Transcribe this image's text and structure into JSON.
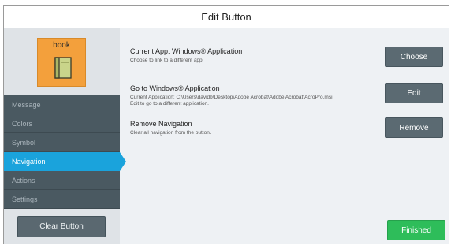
{
  "dialog": {
    "title": "Edit Button"
  },
  "preview": {
    "label": "book",
    "icon": "book-icon"
  },
  "sidebar": {
    "items": [
      {
        "label": "Message",
        "active": false
      },
      {
        "label": "Colors",
        "active": false
      },
      {
        "label": "Symbol",
        "active": false
      },
      {
        "label": "Navigation",
        "active": true
      },
      {
        "label": "Actions",
        "active": false
      },
      {
        "label": "Settings",
        "active": false
      }
    ],
    "clear_button": "Clear Button"
  },
  "sections": {
    "current_app": {
      "title": "Current App: Windows® Application",
      "description": "Choose to link to a different app.",
      "button": "Choose"
    },
    "go_to": {
      "title": "Go to Windows® Application",
      "line1": "Current Application: C:\\Users\\davidb\\Desktop\\Adobe Acrobat\\Adobe Acrobat\\AcroPro.msi",
      "line2": "Edit to go to a different application.",
      "button": "Edit"
    },
    "remove": {
      "title": "Remove Navigation",
      "description": "Clear all navigation from the button.",
      "button": "Remove"
    }
  },
  "footer": {
    "finished": "Finished"
  },
  "colors": {
    "accent": "#1aa3dc",
    "finished": "#2ebd5a",
    "sidebar_dark": "#4a5961",
    "preview_bg": "#f3a03c"
  }
}
